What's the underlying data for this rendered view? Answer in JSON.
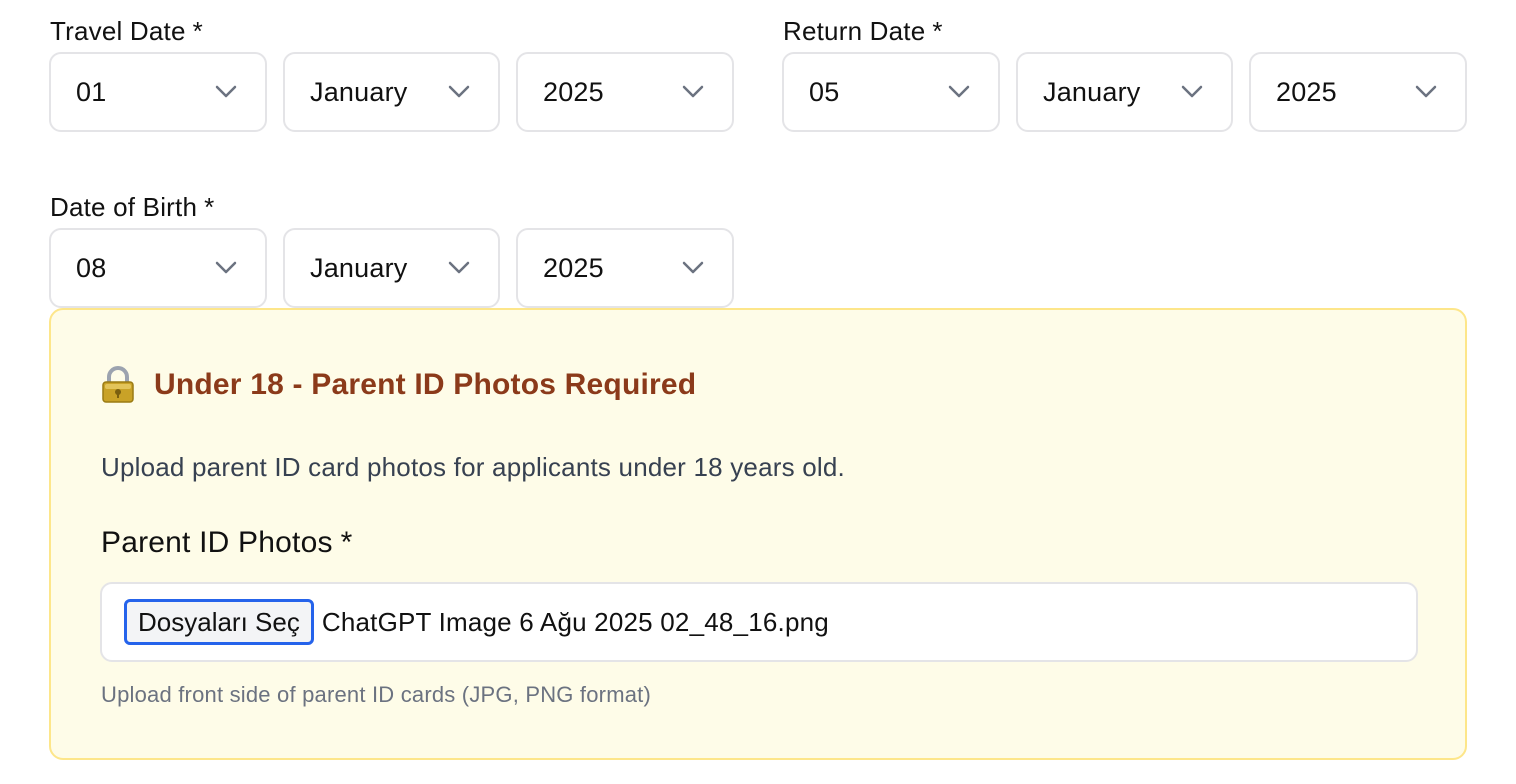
{
  "travel_date": {
    "label": "Travel Date",
    "required_mark": "*",
    "day": "01",
    "month": "January",
    "year": "2025"
  },
  "return_date": {
    "label": "Return Date",
    "required_mark": "*",
    "day": "05",
    "month": "January",
    "year": "2025"
  },
  "date_of_birth": {
    "label": "Date of Birth",
    "required_mark": "*",
    "day": "08",
    "month": "January",
    "year": "2025"
  },
  "parent_notice": {
    "icon": "lock-icon",
    "title": "Under 18 - Parent ID Photos Required",
    "description": "Upload parent ID card photos for applicants under 18 years old.",
    "upload_label": "Parent ID Photos",
    "required_mark": "*",
    "choose_files_button": "Dosyaları Seç",
    "selected_file": "ChatGPT Image 6 Ağu 2025 02_48_16.png",
    "hint": "Upload front side of parent ID cards (JPG, PNG format)"
  },
  "colors": {
    "notice_background": "#fefce8",
    "notice_border": "#fde68a",
    "notice_title": "#8b3a1a",
    "focus_ring": "#2563eb"
  }
}
